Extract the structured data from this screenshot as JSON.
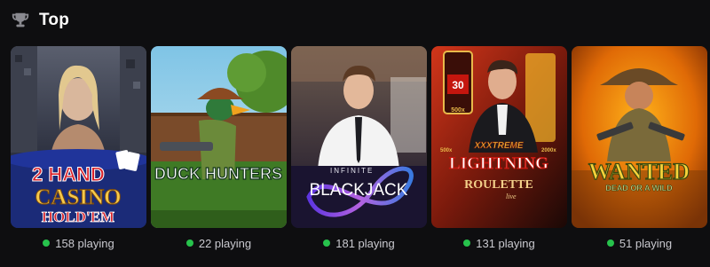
{
  "section": {
    "title": "Top",
    "icon": "trophy-icon"
  },
  "colors": {
    "background": "#0e0e10",
    "online": "#27c24c"
  },
  "games": [
    {
      "name_line1": "2 HAND",
      "name_line2": "CASINO",
      "name_line3": "HOLD'EM",
      "players": "158 playing"
    },
    {
      "name_line1": "DUCK HUNTERS",
      "players": "22 playing"
    },
    {
      "name_prefix": "INFINITE",
      "name_line1": "BLACKJACK",
      "players": "181 playing"
    },
    {
      "badge_top": "30",
      "badge_bottom": "500x",
      "name_prefix": "XXXTREME",
      "multiplier_left": "500x",
      "multiplier_right": "2000x",
      "name_line1": "LIGHTNING",
      "name_line2": "ROULETTE",
      "name_tag": "live",
      "players": "131 playing"
    },
    {
      "name_line1": "WANTED",
      "name_line2": "DEAD OR A WILD",
      "players": "51 playing"
    }
  ]
}
